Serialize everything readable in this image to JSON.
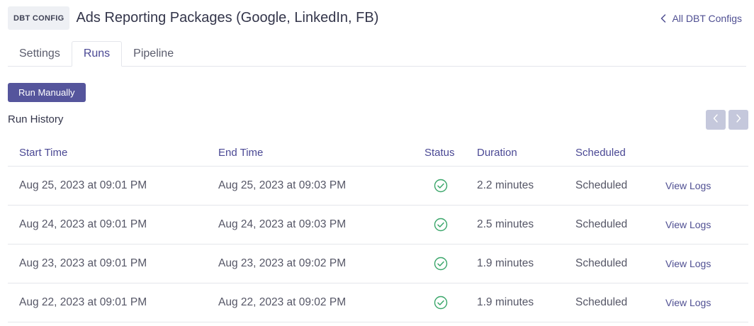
{
  "header": {
    "badge": "DBT CONFIG",
    "title": "Ads Reporting Packages (Google, LinkedIn, FB)",
    "back_link": "All DBT Configs"
  },
  "tabs": [
    {
      "label": "Settings",
      "active": false
    },
    {
      "label": "Runs",
      "active": true
    },
    {
      "label": "Pipeline",
      "active": false
    }
  ],
  "actions": {
    "run_manually": "Run Manually"
  },
  "run_history": {
    "title": "Run History",
    "columns": {
      "start": "Start Time",
      "end": "End Time",
      "status": "Status",
      "duration": "Duration",
      "scheduled": "Scheduled"
    },
    "rows": [
      {
        "start": "Aug 25, 2023 at 09:01 PM",
        "end": "Aug 25, 2023 at 09:03 PM",
        "status": "success",
        "duration": "2.2 minutes",
        "scheduled": "Scheduled",
        "action": "View Logs"
      },
      {
        "start": "Aug 24, 2023 at 09:01 PM",
        "end": "Aug 24, 2023 at 09:03 PM",
        "status": "success",
        "duration": "2.5 minutes",
        "scheduled": "Scheduled",
        "action": "View Logs"
      },
      {
        "start": "Aug 23, 2023 at 09:01 PM",
        "end": "Aug 23, 2023 at 09:02 PM",
        "status": "success",
        "duration": "1.9 minutes",
        "scheduled": "Scheduled",
        "action": "View Logs"
      },
      {
        "start": "Aug 22, 2023 at 09:01 PM",
        "end": "Aug 22, 2023 at 09:02 PM",
        "status": "success",
        "duration": "1.9 minutes",
        "scheduled": "Scheduled",
        "action": "View Logs"
      }
    ]
  },
  "colors": {
    "accent": "#55559c",
    "link": "#4f4f92",
    "success": "#3aa66a",
    "pager": "#c5c8dc"
  },
  "icons": {
    "back": "chevron-left-icon",
    "prev": "chevron-left-icon",
    "next": "chevron-right-icon",
    "status_success": "check-circle-icon"
  }
}
